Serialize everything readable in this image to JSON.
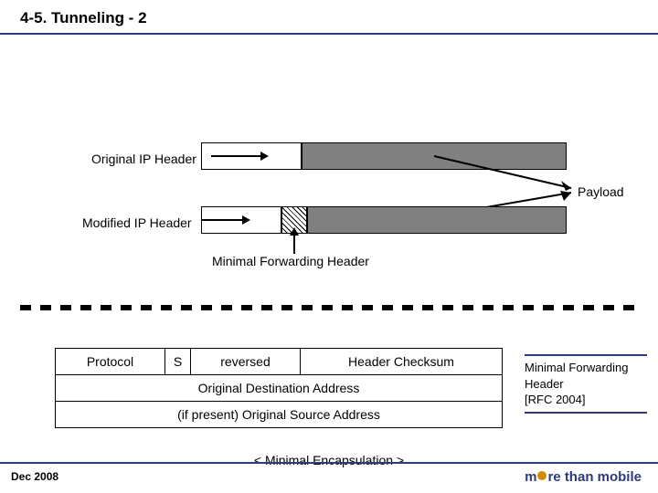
{
  "title": "4-5. Tunneling - 2",
  "diagram": {
    "orig_label": "Original IP Header",
    "mod_label": "Modified IP Header",
    "payload_label": "Payload",
    "mfh_label": "Minimal Forwarding Header"
  },
  "table": {
    "protocol": "Protocol",
    "s": "S",
    "reversed": "reversed",
    "checksum": "Header Checksum",
    "orig_dest": "Original Destination Address",
    "orig_src": "(if present) Original Source Address"
  },
  "caption": {
    "line1": "Minimal Forwarding Header",
    "line2": "[RFC 2004]"
  },
  "bottom_caption": "< Minimal Encapsulation >",
  "footer": {
    "date": "Dec  2008",
    "brand_pre": "m",
    "brand_post": "re than mobile"
  }
}
